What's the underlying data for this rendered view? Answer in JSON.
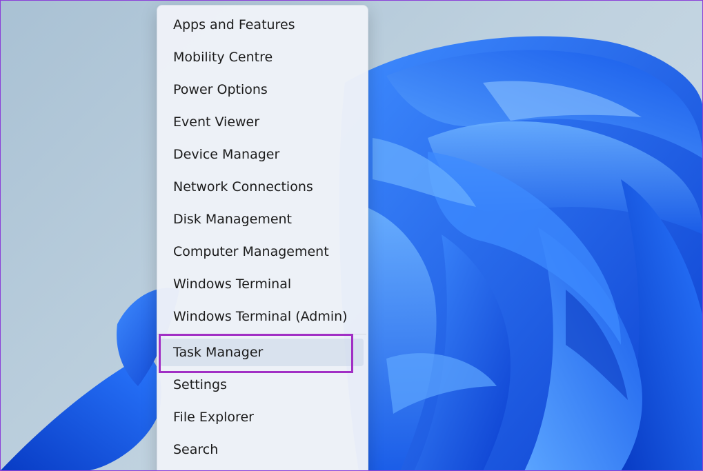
{
  "colors": {
    "annotation_box": "#a12fc4",
    "wallpaper_blue": "#1f6df0"
  },
  "wallpaper": {
    "name": "windows-11-bloom-wallpaper"
  },
  "context_menu": {
    "items": [
      {
        "label": "Apps and Features"
      },
      {
        "label": "Mobility Centre"
      },
      {
        "label": "Power Options"
      },
      {
        "label": "Event Viewer"
      },
      {
        "label": "Device Manager"
      },
      {
        "label": "Network Connections"
      },
      {
        "label": "Disk Management"
      },
      {
        "label": "Computer Management"
      },
      {
        "label": "Windows Terminal"
      },
      {
        "label": "Windows Terminal (Admin)"
      },
      {
        "label": "Task Manager",
        "selected": true
      },
      {
        "label": "Settings"
      },
      {
        "label": "File Explorer"
      },
      {
        "label": "Search"
      }
    ]
  }
}
